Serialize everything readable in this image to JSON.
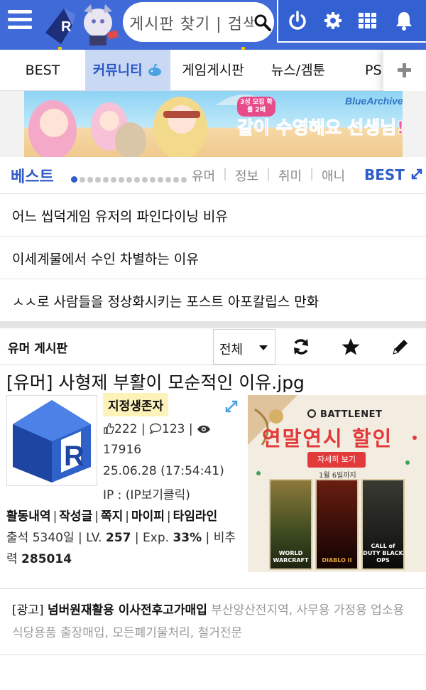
{
  "header": {
    "search_placeholder": "게시판 찾기 | 검색"
  },
  "tabs": [
    {
      "label": "BEST"
    },
    {
      "label": "커뮤니티"
    },
    {
      "label": "게임게시판"
    },
    {
      "label": "뉴스/겜툰"
    },
    {
      "label": "PS"
    }
  ],
  "banner": {
    "alt": "블루아카이브 같이 수영해요 선생님!",
    "logo_text": "BlueArchive",
    "headline": "같이 수영해요 선생님!",
    "tag": "3성 모집 확률 2배"
  },
  "best": {
    "title": "베스트",
    "categories": [
      "유머",
      "정보",
      "취미",
      "애니"
    ],
    "more_label": "BEST",
    "pager_total": 15,
    "pager_current": 1,
    "items": [
      "어느 씹덕게임 유저의 파인다이닝 비유",
      "이세계물에서 수인 차별하는 이유",
      "ㅅㅅ로 사람들을 정상화시키는 포스트 아포칼립스 만화"
    ]
  },
  "board": {
    "name": "유머 게시판",
    "filter": "전체"
  },
  "post": {
    "title": "[유머] 사형제 부활이 모순적인 이유.jpg",
    "author_badge": "지정생존자",
    "likes": "222",
    "comments": "123",
    "views": "17916",
    "datetime": "25.06.28 (17:54:41)",
    "ip": "IP : (IP보기클릭)",
    "links": [
      "활동내역",
      "작성글",
      "쪽지",
      "마이피",
      "타임라인"
    ],
    "attendance_label": "출석",
    "attendance": "5340일",
    "level_label": "LV.",
    "level": "257",
    "exp_label": "Exp.",
    "exp": "33%",
    "ratio_label": "비추력",
    "ratio": "285014"
  },
  "ad_image": {
    "brand": "BATTLENET",
    "headline": "연말연시 할인",
    "button": "자세히 보기",
    "date": "1월 6일까지",
    "games": [
      "WORLD WARCRAFT",
      "DIABLO II",
      "CALL of DUTY BLACK OPS"
    ]
  },
  "ad_text": {
    "tag": "[광고]",
    "title": "넘버원재활용 이사전후고가매입",
    "body": "부산양산전지역, 사무용 가정용 업소용 식당용품 출장매입, 모든폐기물처리, 철거전문"
  },
  "colors": {
    "header_bg": "#3f6ad8",
    "accent": "#2e5bc7",
    "active_tab_bg": "#c9d8f3",
    "badge_bg": "#fdf2b8",
    "ad_red": "#e23a3a"
  }
}
